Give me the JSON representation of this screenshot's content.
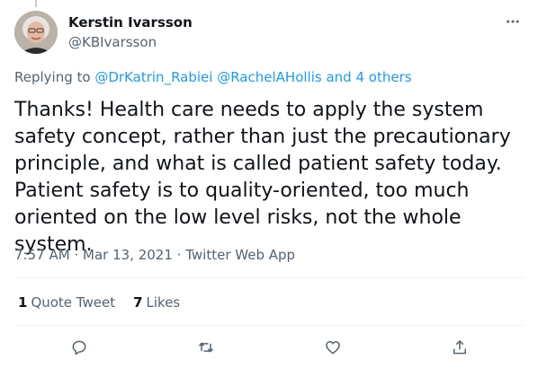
{
  "author": {
    "display_name": "Kerstin Ivarsson",
    "handle": "@KBIvarsson",
    "avatar_icon": "portrait-avatar"
  },
  "reply": {
    "prefix": "Replying to",
    "mention1": "@DrKatrin_Rabiei",
    "mention2": "@RachelAHollis",
    "others": "and 4 others"
  },
  "tweet": {
    "text": "Thanks! Health care needs to apply the system safety concept, rather than just the precautionary principle, and what is called patient safety today. Patient safety is to quality-oriented, too much oriented on the low level risks, not the whole system."
  },
  "meta": {
    "time": "7:57 AM",
    "separator": "·",
    "date": "Mar 13, 2021",
    "source": "Twitter Web App"
  },
  "stats": {
    "quote_count": "1",
    "quote_label": "Quote Tweet",
    "like_count": "7",
    "like_label": "Likes"
  },
  "colors": {
    "link": "#1d9bf0",
    "secondary_text": "#536471",
    "primary_text": "#0f1419",
    "divider": "#eff3f4"
  },
  "icons": {
    "more": "more-options-icon",
    "reply": "reply-icon",
    "retweet": "retweet-icon",
    "like": "like-icon",
    "share": "share-icon"
  }
}
